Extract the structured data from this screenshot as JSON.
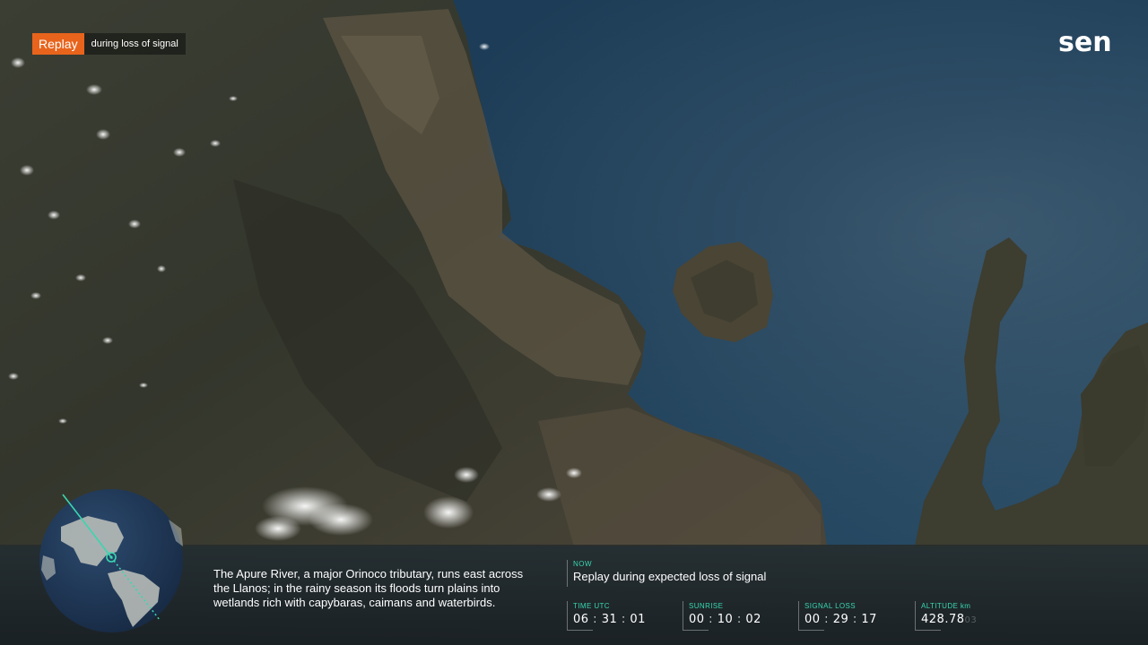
{
  "replay": {
    "badge_label": "Replay",
    "description": "during loss of signal"
  },
  "logo": {
    "text": "sen"
  },
  "caption": {
    "text": "The Apure River, a major Orinoco tributary, runs east across the Llanos; in the rainy season its floods turn plains into wetlands rich with capybaras, caimans and waterbirds."
  },
  "now": {
    "label": "NOW",
    "text": "Replay during expected loss of signal"
  },
  "metrics": [
    {
      "label": "TIME UTC",
      "hh": "06",
      "mm": "31",
      "ss": "01"
    },
    {
      "label": "SUNRISE",
      "hh": "00",
      "mm": "10",
      "ss": "02"
    },
    {
      "label": "SIGNAL LOSS",
      "hh": "00",
      "mm": "29",
      "ss": "17"
    },
    {
      "label": "ALTITUDE km",
      "value": "428.78",
      "trailing": "03"
    }
  ],
  "globe": {
    "icon": "globe-orbit-icon"
  },
  "colors": {
    "accent_orange": "#e8641c",
    "accent_teal": "#39d6b0"
  }
}
